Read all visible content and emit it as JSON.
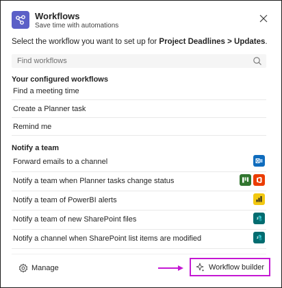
{
  "header": {
    "title": "Workflows",
    "subtitle": "Save time with automations"
  },
  "prompt": {
    "prefix": "Select the workflow you want to set up for ",
    "team": "Project Deadlines",
    "separator": " > ",
    "channel": "Updates",
    "suffix": "."
  },
  "search": {
    "placeholder": "Find workflows",
    "value": ""
  },
  "configured": {
    "title": "Your configured workflows",
    "items": [
      {
        "label": "Find a meeting time"
      },
      {
        "label": "Create a Planner task"
      },
      {
        "label": "Remind me"
      }
    ]
  },
  "notify": {
    "title": "Notify a team",
    "items": [
      {
        "label": "Forward emails to a channel",
        "icons": [
          "outlook-icon"
        ]
      },
      {
        "label": "Notify a team when Planner tasks change status",
        "icons": [
          "planner-icon",
          "office-icon"
        ]
      },
      {
        "label": "Notify a team of PowerBI alerts",
        "icons": [
          "powerbi-icon"
        ]
      },
      {
        "label": "Notify a team of new SharePoint files",
        "icons": [
          "sharepoint-icon"
        ]
      },
      {
        "label": "Notify a channel when SharePoint list items are modified",
        "icons": [
          "sharepoint-icon"
        ]
      }
    ]
  },
  "footer": {
    "manage_label": "Manage",
    "builder_label": "Workflow builder"
  },
  "colors": {
    "accent": "#5b5fc7",
    "highlight": "#c417d3",
    "outlook": "#0f6cbd",
    "planner": "#31752f",
    "office": "#eb3c00",
    "powerbi": "#f2c811",
    "sharepoint": "#036c70"
  }
}
